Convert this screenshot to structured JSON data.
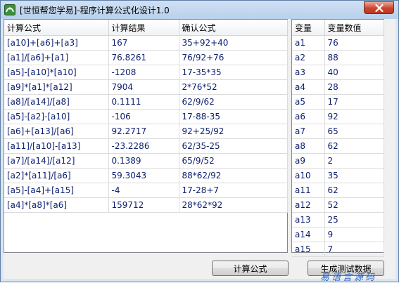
{
  "window": {
    "title": "[世恒帮您学易]-程序计算公式化设计1.0"
  },
  "formula_table": {
    "headers": [
      "计算公式",
      "计算结果",
      "确认公式"
    ],
    "rows": [
      [
        "[a10]+[a6]+[a3]",
        "167",
        "35+92+40"
      ],
      [
        "[a1]/[a6]+[a1]",
        "76.8261",
        "76/92+76"
      ],
      [
        "[a5]-[a10]*[a10]",
        "-1208",
        "17-35*35"
      ],
      [
        "[a9]*[a1]*[a12]",
        "7904",
        "2*76*52"
      ],
      [
        "[a8]/[a14]/[a8]",
        "0.1111",
        "62/9/62"
      ],
      [
        "[a5]-[a2]-[a10]",
        "-106",
        "17-88-35"
      ],
      [
        "[a6]+[a13]/[a6]",
        "92.2717",
        "92+25/92"
      ],
      [
        "[a11]/[a10]-[a13]",
        "-23.2286",
        "62/35-25"
      ],
      [
        "[a7]/[a14]/[a12]",
        "0.1389",
        "65/9/52"
      ],
      [
        "[a2]*[a11]/[a6]",
        "59.3043",
        "88*62/92"
      ],
      [
        "[a5]-[a4]+[a15]",
        "-4",
        "17-28+7"
      ],
      [
        "[a4]*[a8]*[a6]",
        "159712",
        "28*62*92"
      ]
    ]
  },
  "variable_table": {
    "headers": [
      "变量",
      "变量数值"
    ],
    "rows": [
      [
        "a1",
        "76"
      ],
      [
        "a2",
        "88"
      ],
      [
        "a3",
        "40"
      ],
      [
        "a4",
        "28"
      ],
      [
        "a5",
        "17"
      ],
      [
        "a6",
        "92"
      ],
      [
        "a7",
        "65"
      ],
      [
        "a8",
        "62"
      ],
      [
        "a9",
        "2"
      ],
      [
        "a10",
        "35"
      ],
      [
        "a11",
        "62"
      ],
      [
        "a12",
        "52"
      ],
      [
        "a13",
        "25"
      ],
      [
        "a14",
        "9"
      ],
      [
        "a15",
        "7"
      ]
    ]
  },
  "buttons": {
    "calculate": "计算公式",
    "generate": "生成测试数据"
  },
  "watermark": "易语言源码",
  "icons": {
    "app": "app-icon",
    "close": "close-icon"
  },
  "colors": {
    "cell_text": "#0b1d6e",
    "close_button": "#c9442c",
    "title_bar": "#b9d1ec"
  }
}
